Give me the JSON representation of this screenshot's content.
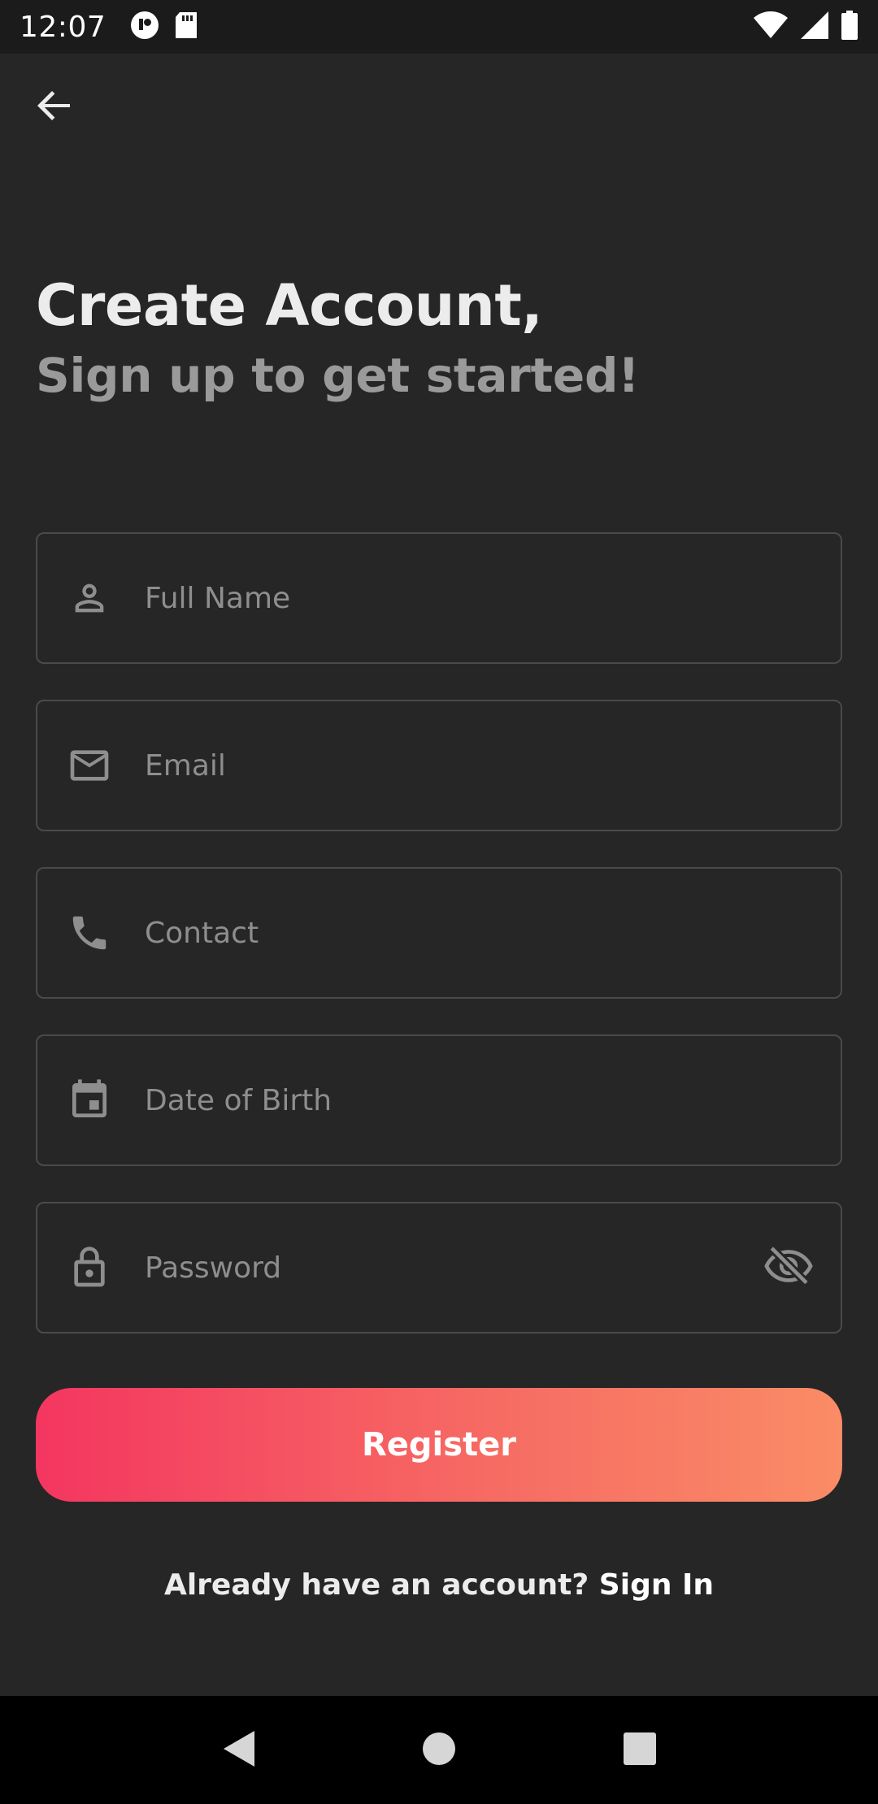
{
  "status_bar": {
    "time": "12:07",
    "icons": [
      "notification-app-icon",
      "sd-card-icon",
      "wifi-icon",
      "cellular-signal-icon",
      "battery-icon"
    ]
  },
  "header": {
    "back_icon": "arrow-left-icon",
    "title": "Create Account,",
    "subtitle": "Sign up to get started!"
  },
  "form": {
    "full_name": {
      "placeholder": "Full Name",
      "value": "",
      "icon": "person-icon"
    },
    "email": {
      "placeholder": "Email",
      "value": "",
      "icon": "mail-icon"
    },
    "contact": {
      "placeholder": "Contact",
      "value": "",
      "icon": "phone-icon"
    },
    "dob": {
      "placeholder": "Date of Birth",
      "value": "",
      "icon": "calendar-icon"
    },
    "password": {
      "placeholder": "Password",
      "value": "",
      "icon": "lock-icon",
      "toggle_icon": "eye-off-icon"
    }
  },
  "register_label": "Register",
  "signin": {
    "prompt": "Already have an account?",
    "link": "Sign In"
  },
  "colors": {
    "background": "#262626",
    "button_gradient_start": "#f43660",
    "button_gradient_end": "#fa8c66",
    "field_border": "#4a4a4a",
    "placeholder": "#8e8e8e",
    "subtitle": "#9a9a9a"
  },
  "nav_bar": {
    "icons": [
      "nav-back-icon",
      "nav-home-icon",
      "nav-recents-icon"
    ]
  }
}
